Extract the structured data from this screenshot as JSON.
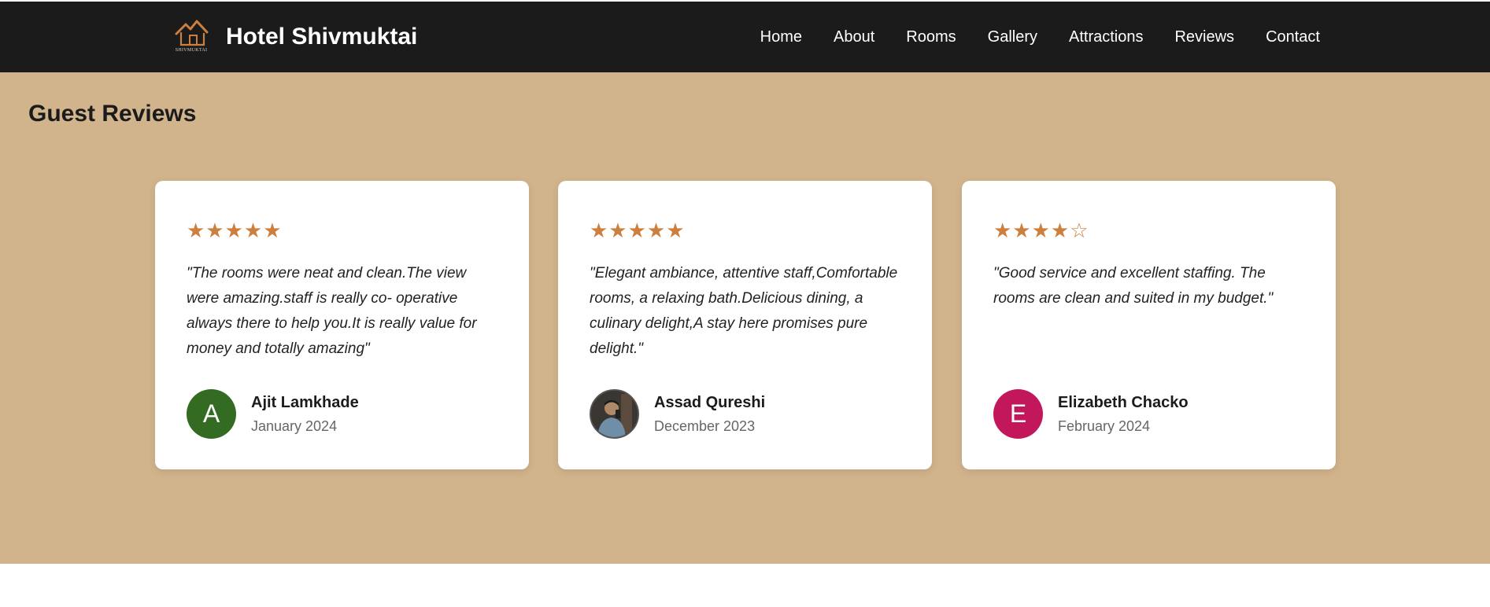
{
  "brand": {
    "name": "Hotel Shivmuktai",
    "logo_text": "SHIVMUKTAI"
  },
  "nav": [
    "Home",
    "About",
    "Rooms",
    "Gallery",
    "Attractions",
    "Reviews",
    "Contact"
  ],
  "reviews_section": {
    "title": "Guest Reviews",
    "star_color": "#cd7f3e",
    "background": "#d2b48c"
  },
  "reviews": [
    {
      "stars": "★★★★★",
      "rating": 5,
      "quote": "\"The rooms were neat and clean.The view were amazing.staff is really co- operative always there to help you.It is really value for money and totally amazing\"",
      "name": "Ajit Lamkhade",
      "date": "January 2024",
      "avatar_letter": "A",
      "avatar_color": "#336b22"
    },
    {
      "stars": "★★★★★",
      "rating": 5,
      "quote": "\"Elegant ambiance, attentive staff,Comfortable rooms, a relaxing bath.Delicious dining, a culinary delight,A stay here promises pure delight.\"",
      "name": "Assad Qureshi",
      "date": "December 2023",
      "avatar_letter": "",
      "avatar_color": "#2e2e2e"
    },
    {
      "stars": "★★★★☆",
      "rating": 4,
      "quote": "\"Good service and excellent staffing. The rooms are clean and suited in my budget.\"",
      "name": "Elizabeth Chacko",
      "date": "February 2024",
      "avatar_letter": "E",
      "avatar_color": "#c2185b"
    }
  ]
}
